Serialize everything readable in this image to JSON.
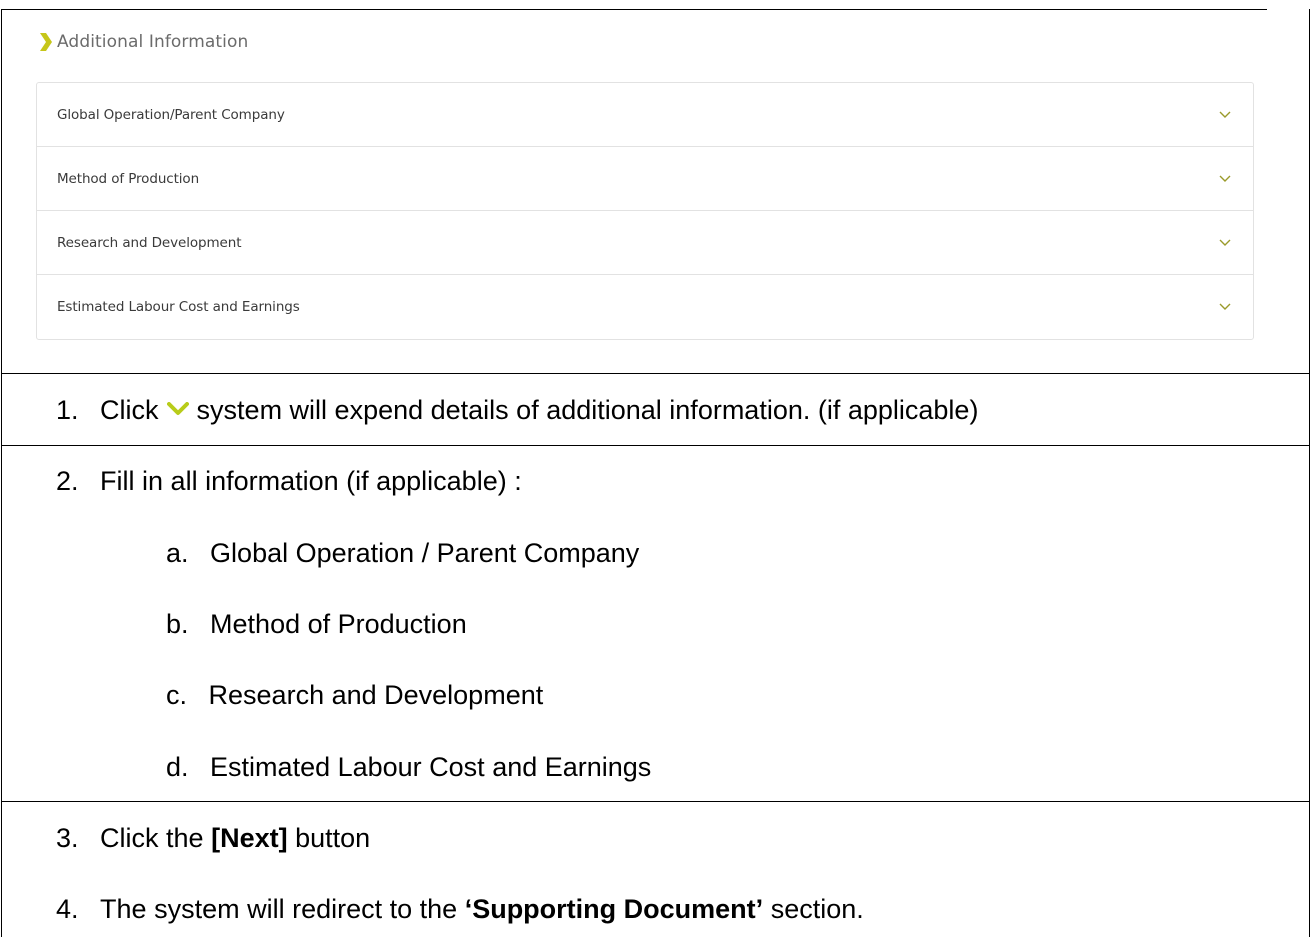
{
  "screenshot": {
    "section_title": "Additional Information",
    "accordion_items": [
      {
        "label": "Global Operation/Parent Company",
        "icon": "chevron-down-icon"
      },
      {
        "label": "Method of Production",
        "icon": "chevron-down-icon"
      },
      {
        "label": "Research and Development",
        "icon": "chevron-down-icon"
      },
      {
        "label": "Estimated Labour Cost and Earnings",
        "icon": "chevron-down-icon"
      }
    ],
    "colors": {
      "accent": "#c6c619",
      "chevron": "#9a9a2a",
      "border": "#e2e2e2",
      "title": "#6b6b6b"
    }
  },
  "steps": {
    "step1": {
      "num": "1.",
      "before": "Click",
      "after": "system will expend details of additional information. (if applicable)"
    },
    "step2": {
      "num": "2.",
      "text": "Fill in all information (if applicable) :",
      "subitems": [
        {
          "letter": "a.",
          "text": "Global Operation / Parent Company"
        },
        {
          "letter": "b.",
          "text": "Method of Production"
        },
        {
          "letter": "c.",
          "text": "Research and Development"
        },
        {
          "letter": "d.",
          "text": "Estimated Labour Cost and Earnings"
        }
      ]
    },
    "step3": {
      "num": "3.",
      "before": "Click the",
      "bold": "[Next]",
      "after": "button"
    },
    "step4": {
      "num": "4.",
      "before": "The system will redirect to the",
      "bold": "‘Supporting Document’",
      "after": "section."
    }
  }
}
